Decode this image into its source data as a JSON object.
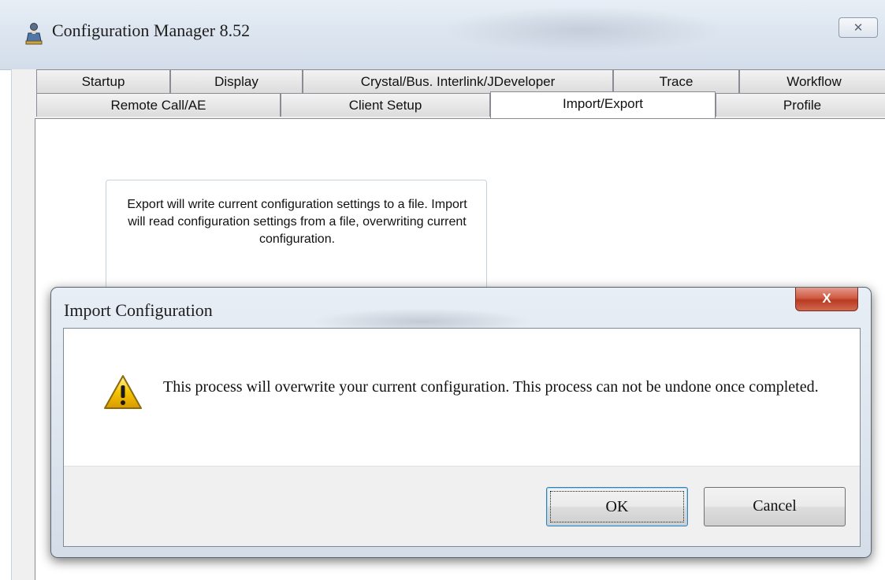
{
  "window": {
    "title": "Configuration Manager 8.52",
    "close_glyph": "✕"
  },
  "tabs": {
    "row1": [
      {
        "label": "Startup"
      },
      {
        "label": "Display"
      },
      {
        "label": "Crystal/Bus. Interlink/JDeveloper"
      },
      {
        "label": "Trace"
      },
      {
        "label": "Workflow"
      }
    ],
    "row2": [
      {
        "label": "Remote Call/AE"
      },
      {
        "label": "Client Setup"
      },
      {
        "label": "Import/Export",
        "active": true
      },
      {
        "label": "Profile"
      }
    ]
  },
  "panel": {
    "info_text": "Export will write current configuration settings to a file. Import will read configuration settings from a file, overwriting current configuration."
  },
  "dialog": {
    "title": "Import Configuration",
    "close_glyph": "X",
    "message": "This process will overwrite your current configuration.  This process can not be undone once completed.",
    "ok_label": "OK",
    "cancel_label": "Cancel",
    "icon": "warning-icon"
  },
  "colors": {
    "dialog_close_red": "#c9452c",
    "ok_focus_blue": "#3c7fb1",
    "warning_yellow": "#f5c400"
  }
}
